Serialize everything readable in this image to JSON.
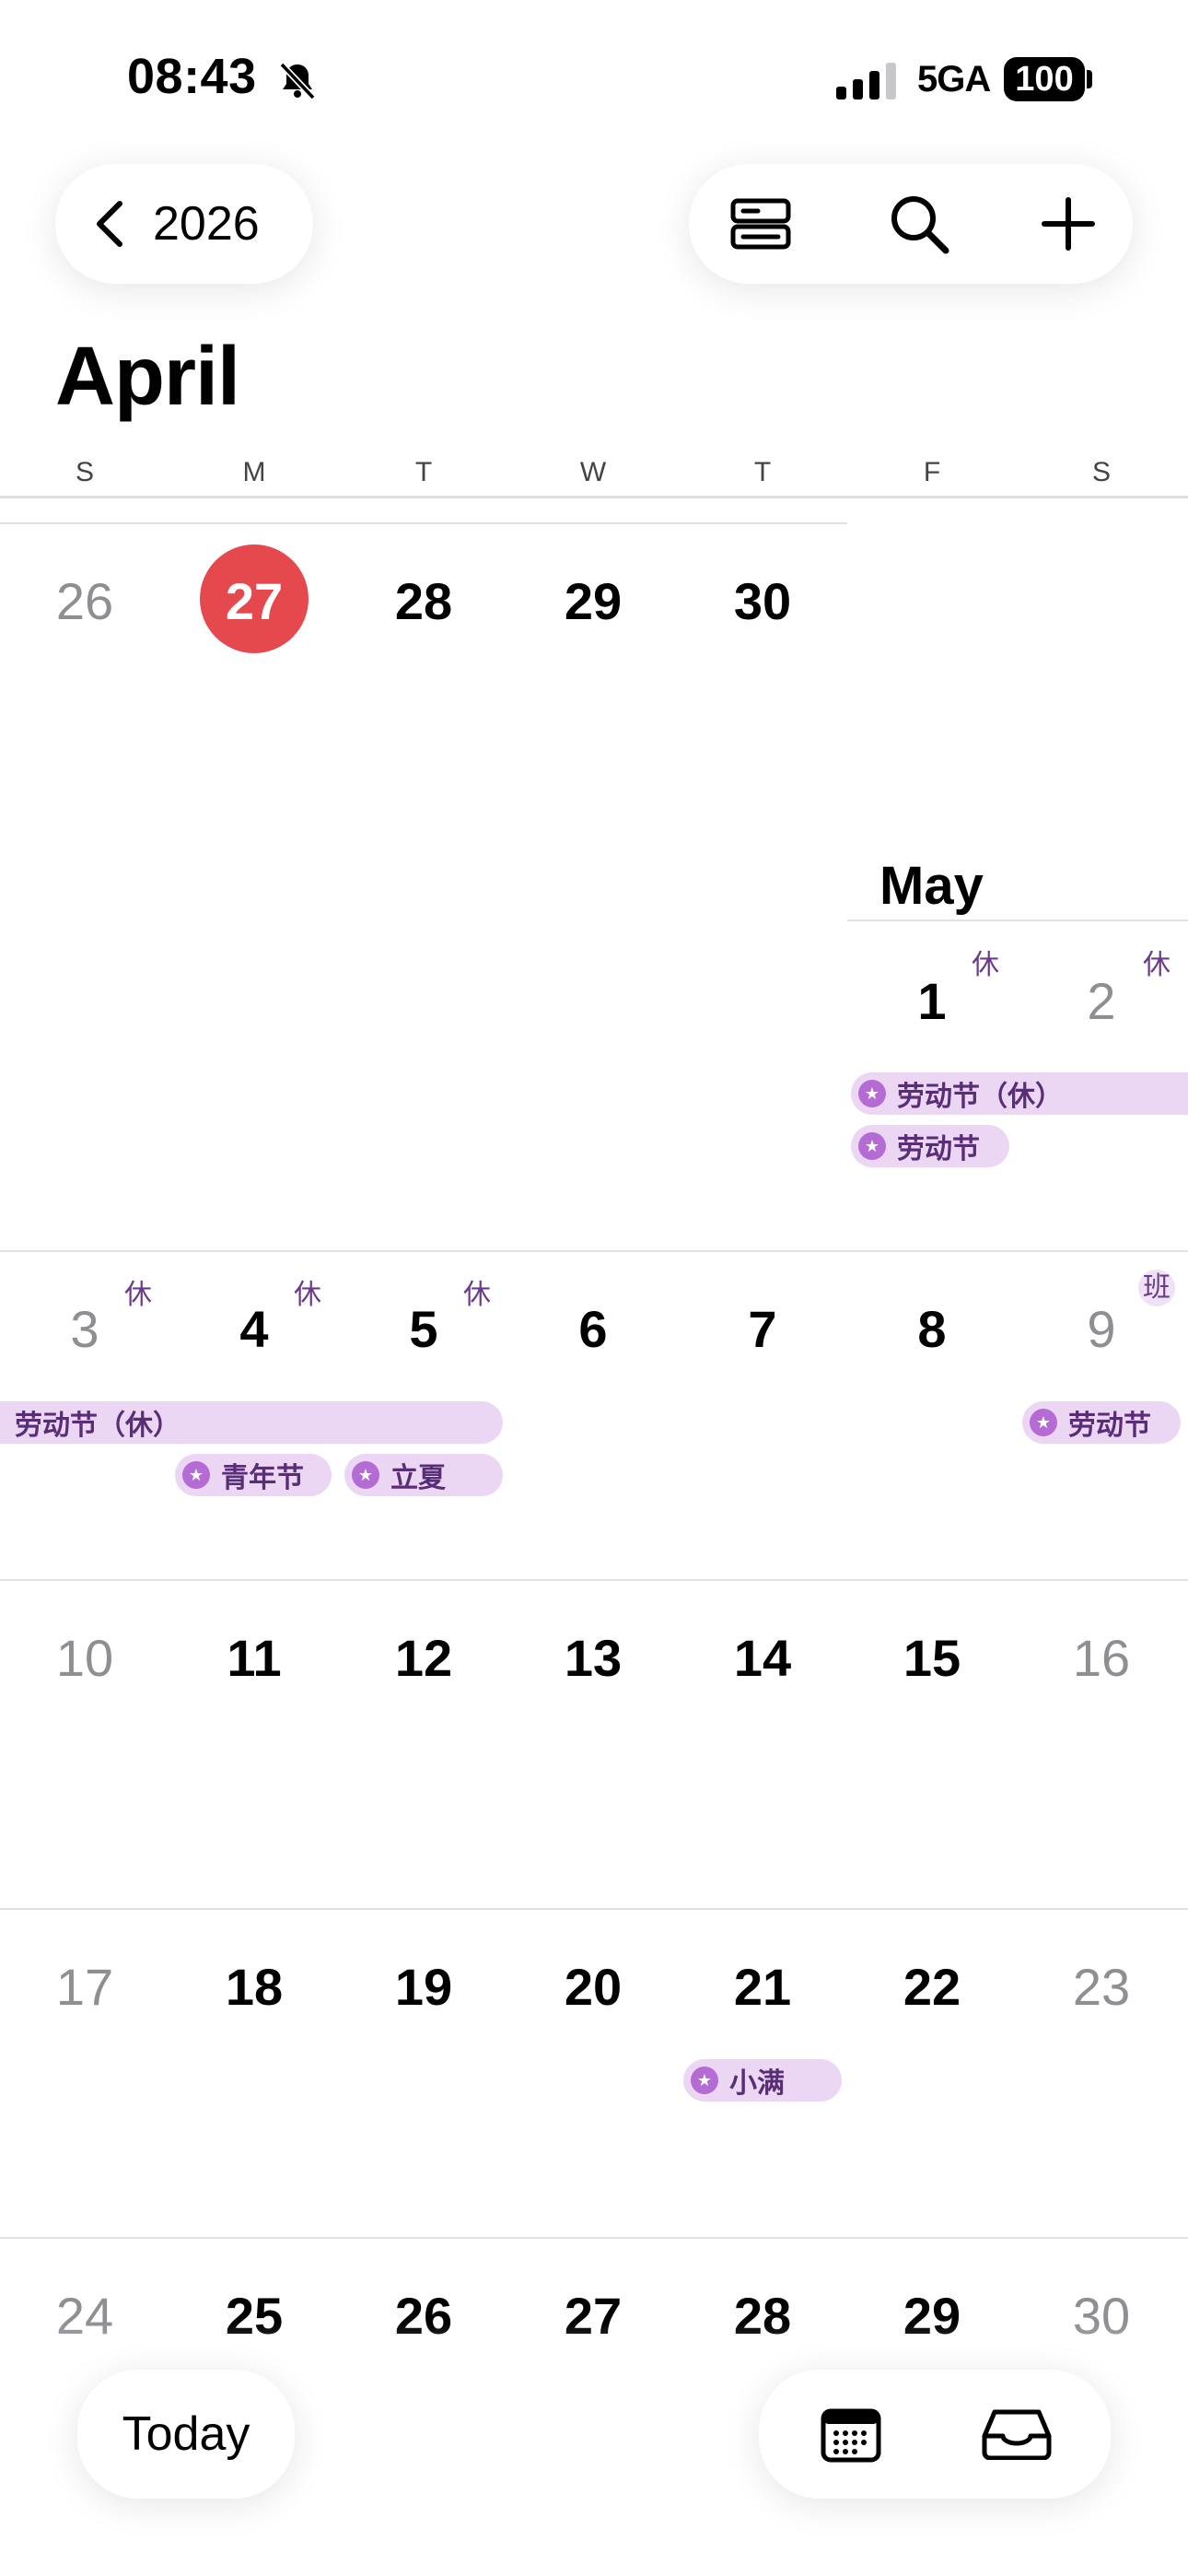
{
  "status_bar": {
    "time": "08:43",
    "network": "5GA",
    "battery": "100"
  },
  "header": {
    "back_year": "2026",
    "month": "April",
    "next_month": "May"
  },
  "weekdays": [
    "S",
    "M",
    "T",
    "W",
    "T",
    "F",
    "S"
  ],
  "colors": {
    "today_accent": "#e5484d",
    "holiday_event_bg": "#ebd7f4",
    "holiday_text": "#5a2d77"
  },
  "weeks": {
    "w1": {
      "d0": "26",
      "d1": "27",
      "d2": "28",
      "d3": "29",
      "d4": "30"
    },
    "w1b": {
      "d5": "1",
      "d6": "2"
    },
    "w2": {
      "d0": "3",
      "d1": "4",
      "d2": "5",
      "d3": "6",
      "d4": "7",
      "d5": "8",
      "d6": "9"
    },
    "w3": {
      "d0": "10",
      "d1": "11",
      "d2": "12",
      "d3": "13",
      "d4": "14",
      "d5": "15",
      "d6": "16"
    },
    "w4": {
      "d0": "17",
      "d1": "18",
      "d2": "19",
      "d3": "20",
      "d4": "21",
      "d5": "22",
      "d6": "23"
    },
    "w5": {
      "d0": "24",
      "d1": "25",
      "d2": "26",
      "d3": "27",
      "d4": "28",
      "d5": "29",
      "d6": "30"
    }
  },
  "markers": {
    "rest": "休",
    "work": "班"
  },
  "events": {
    "labor_day_rest": "劳动节（休）",
    "labor_day": "劳动节",
    "youth_day": "青年节",
    "lixia": "立夏",
    "xiaoman": "小满"
  },
  "bottom_bar": {
    "today_label": "Today"
  },
  "icons": {
    "back": "chevron-left-icon",
    "view_toggle": "list-view-icon",
    "search": "search-icon",
    "add": "plus-icon",
    "calendar": "calendar-icon",
    "inbox": "inbox-icon",
    "mute": "bell-slash-icon",
    "signal": "signal-icon"
  }
}
